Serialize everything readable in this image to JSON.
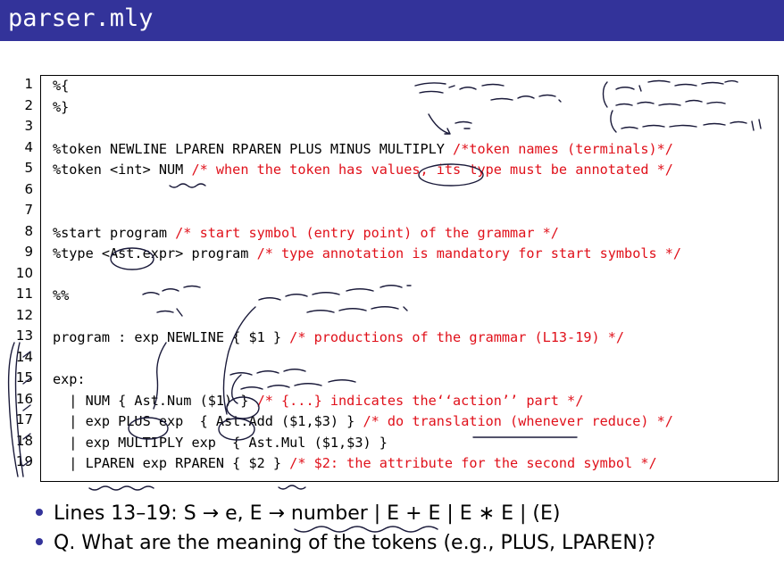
{
  "slide": {
    "title": "parser.mly"
  },
  "code": {
    "line_numbers": [
      "1",
      "2",
      "3",
      "4",
      "5",
      "6",
      "7",
      "8",
      "9",
      "10",
      "11",
      "12",
      "13",
      "14",
      "15",
      "16",
      "17",
      "18",
      "19"
    ],
    "lines": [
      {
        "code": "%{",
        "comment": ""
      },
      {
        "code": "%}",
        "comment": ""
      },
      {
        "code": "",
        "comment": ""
      },
      {
        "code": "%token NEWLINE LPAREN RPAREN PLUS MINUS MULTIPLY ",
        "comment": "/*token names (terminals)*/"
      },
      {
        "code": "%token <int> NUM ",
        "comment": "/* when the token has values, its type must be annotated */"
      },
      {
        "code": "",
        "comment": ""
      },
      {
        "code": "",
        "comment": ""
      },
      {
        "code": "%start program ",
        "comment": "/* start symbol (entry point) of the grammar */"
      },
      {
        "code": "%type <Ast.expr> program ",
        "comment": "/* type annotation is mandatory for start symbols */"
      },
      {
        "code": "",
        "comment": ""
      },
      {
        "code": "%%",
        "comment": ""
      },
      {
        "code": "",
        "comment": ""
      },
      {
        "code": "program : exp NEWLINE { $1 } ",
        "comment": "/* productions of the grammar (L13-19) */"
      },
      {
        "code": "",
        "comment": ""
      },
      {
        "code": "exp:",
        "comment": ""
      },
      {
        "code": "  | NUM { Ast.Num ($1) } ",
        "comment": "/* {...} indicates the‘‘action’’ part */"
      },
      {
        "code": "  | exp PLUS exp  { Ast.Add ($1,$3) } ",
        "comment": "/* do translation (whenever reduce) */"
      },
      {
        "code": "  | exp MULTIPLY exp  { Ast.Mul ($1,$3) }",
        "comment": ""
      },
      {
        "code": "  | LPAREN exp RPAREN { $2 } ",
        "comment": "/* $2: the attribute for the second symbol */"
      }
    ]
  },
  "handwritten": {
    "top_line_1": "(",
    "top_line_1b": ", parser",
    "top_line_2": "logic",
    "top_line_3": "lexer",
    "left_note_1": "Ast.Add",
    "middle_note_1": "parse 1st grammar symbol.",
    "middle_note_2": "(non terminal)",
    "lower_note_1": "construct",
    "lower_note_2": "sub syntax tree"
  },
  "bullets": [
    "Lines 13–19: S → e,  E → number | E + E | E ∗ E | (E)",
    "Q. What are the meaning of the tokens (e.g., PLUS, LPAREN)?"
  ],
  "colors": {
    "title_bar": "#33339a",
    "comment": "#e0101a",
    "ink": "#1a1a3a"
  }
}
